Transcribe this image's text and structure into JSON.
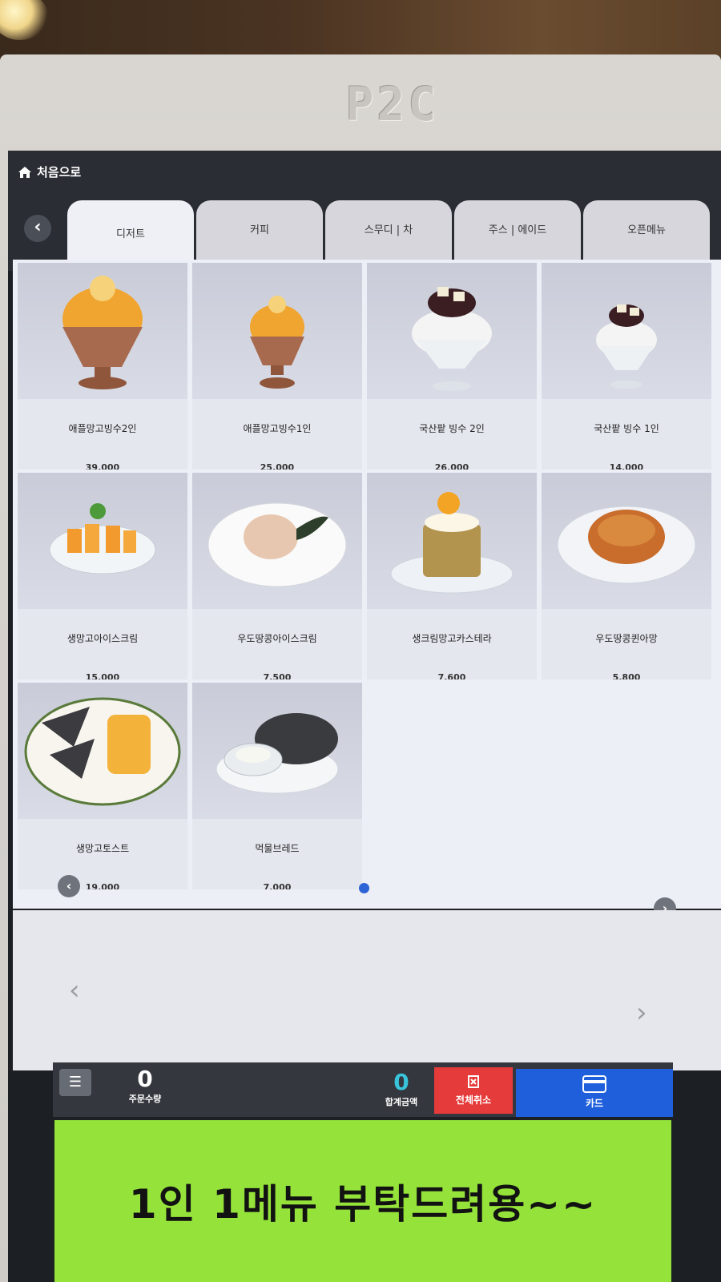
{
  "device": {
    "brand": "P2C"
  },
  "header": {
    "home_label": "처음으로"
  },
  "tabs": [
    {
      "label": "디저트",
      "active": true
    },
    {
      "label": "커피"
    },
    {
      "label": "스무디 | 차"
    },
    {
      "label": "주스 | 에이드"
    },
    {
      "label": "오픈메뉴"
    }
  ],
  "menu_items": [
    {
      "name": "애플망고빙수2인",
      "price": "39,000",
      "photo": "mango-bingsu-icon"
    },
    {
      "name": "애플망고빙수1인",
      "price": "25,000",
      "photo": "mango-bingsu-icon"
    },
    {
      "name": "국산팥 빙수 2인",
      "price": "26,000",
      "photo": "redbean-bingsu-icon"
    },
    {
      "name": "국산팥 빙수 1인",
      "price": "14,000",
      "photo": "redbean-bingsu-icon"
    },
    {
      "name": "생망고아이스크림",
      "price": "15,000",
      "photo": "mango-icecream-icon"
    },
    {
      "name": "우도땅콩아이스크림",
      "price": "7,500",
      "photo": "peanut-icecream-icon"
    },
    {
      "name": "생크림망고카스테라",
      "price": "7,600",
      "photo": "mango-castella-icon"
    },
    {
      "name": "우도땅콩퀸아망",
      "price": "5,800",
      "photo": "kouign-amann-icon"
    },
    {
      "name": "생망고토스트",
      "price": "19,000",
      "photo": "mango-toast-icon"
    },
    {
      "name": "먹물브레드",
      "price": "7,000",
      "photo": "squid-ink-bread-icon"
    }
  ],
  "order_bar": {
    "quantity": "0",
    "quantity_label": "주문수량",
    "total": "0",
    "total_label": "합계금액",
    "cancel_label": "전체취소",
    "card_label": "카드"
  },
  "notice": "1인 1메뉴 부탁드려용~~",
  "colors": {
    "accent_blue": "#1f5fdc",
    "cancel_red": "#e63b3b",
    "notice_green": "#95e33a",
    "total_cyan": "#39c4dc"
  }
}
